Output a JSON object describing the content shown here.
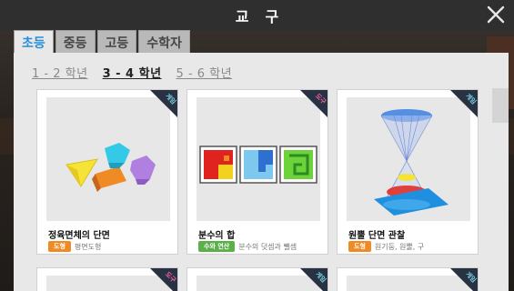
{
  "window": {
    "title": "교구",
    "close_symbol": "✕"
  },
  "tabs": [
    {
      "label": "초등",
      "active": true
    },
    {
      "label": "중등",
      "active": false
    },
    {
      "label": "고등",
      "active": false
    },
    {
      "label": "수학자",
      "active": false
    }
  ],
  "grades": [
    {
      "label": "1 - 2 학년",
      "active": false
    },
    {
      "label": "3 - 4 학년",
      "active": true
    },
    {
      "label": "5 - 6 학년",
      "active": false
    }
  ],
  "cards": [
    {
      "title": "정육면체의 단면",
      "badge": "도형",
      "badge_color": "#f08a24",
      "subtitle": "평면도형",
      "ribbon": "게임",
      "ribbon_color": "#7ad3e6",
      "thumb_icon": "polyhedra-icon"
    },
    {
      "title": "분수의 합",
      "badge": "수와 연산",
      "badge_color": "#5bb04a",
      "subtitle": "분수의 덧셈과 뺄셈",
      "ribbon": "도구",
      "ribbon_color": "#ff5fa8",
      "thumb_icon": "fraction-tiles-icon"
    },
    {
      "title": "원뿔 단면 관찰",
      "badge": "도형",
      "badge_color": "#f08a24",
      "subtitle": "원기둥, 원뿔, 구",
      "ribbon": "게임",
      "ribbon_color": "#7ad3e6",
      "thumb_icon": "double-cone-icon"
    }
  ],
  "next_row": [
    {
      "ribbon": "도구",
      "ribbon_color": "#ff5fa8"
    },
    {
      "ribbon": "게임",
      "ribbon_color": "#7ad3e6"
    },
    {
      "ribbon": "게임",
      "ribbon_color": "#7ad3e6"
    }
  ],
  "colors": {
    "accent_tab": "#2a8fd6",
    "topbar": "#2f2f2f",
    "panel": "#e8e8e8"
  }
}
